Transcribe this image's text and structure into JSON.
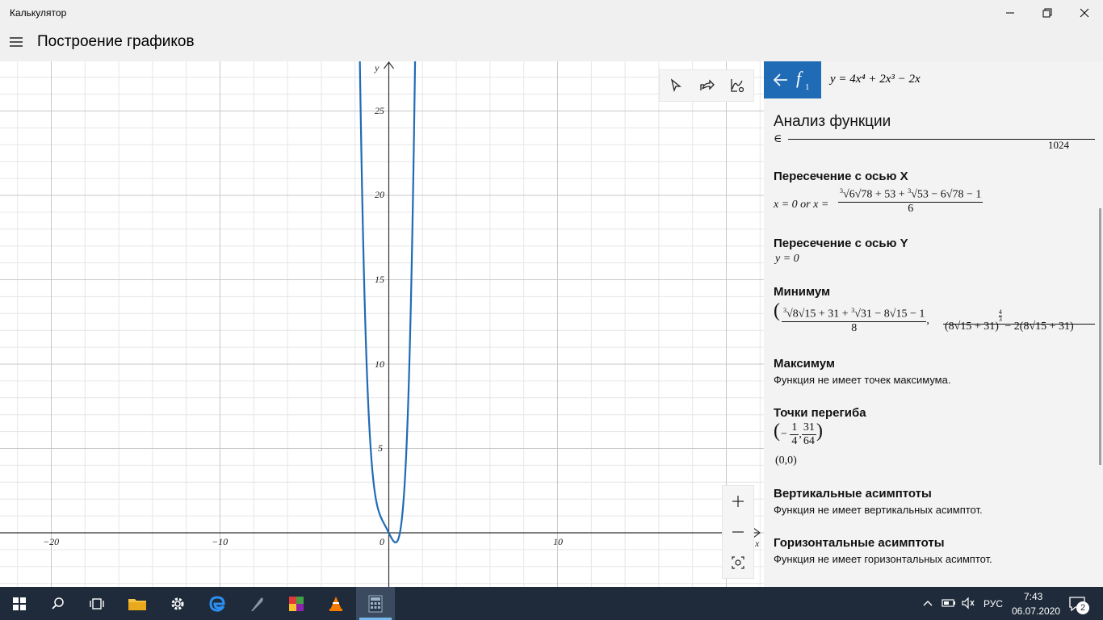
{
  "window": {
    "title": "Калькулятор"
  },
  "header": {
    "mode_title": "Построение графиков"
  },
  "graph": {
    "axis_x_label": "x",
    "axis_y_label": "y",
    "x_ticks": [
      "−20",
      "−10",
      "0",
      "10"
    ],
    "y_ticks": [
      "5",
      "10",
      "15",
      "20",
      "25"
    ]
  },
  "function": {
    "name": "f",
    "index": "1",
    "expression": "y = 4x⁴ + 2x³ − 2x",
    "color": "#1f6bb5"
  },
  "analysis": {
    "title": "Анализ функции",
    "cut_denominator": "1024",
    "x_intercept": {
      "title": "Пересечение с осью X",
      "lhs": "x = 0 or x =",
      "num_a": "6√78 + 53",
      "plus": "+",
      "num_b": "53 − 6√78",
      "minus": "− 1",
      "den": "6"
    },
    "y_intercept": {
      "title": "Пересечение с осью Y",
      "value": "y = 0"
    },
    "minimum": {
      "title": "Минимум",
      "num_a": "8√15 + 31",
      "plus": "+",
      "num_b": "31 − 8√15",
      "minus": "− 1",
      "den": "8",
      "second": "(8√15 + 31)",
      "exp_num": "4",
      "exp_den": "3",
      "second_tail": "− 2(8√15 + 31)"
    },
    "maximum": {
      "title": "Максимум",
      "text": "Функция не имеет точек максимума."
    },
    "inflection": {
      "title": "Точки перегиба",
      "p1_num": "1",
      "p1_den": "4",
      "p2_num": "31",
      "p2_den": "64",
      "origin": "(0,0)"
    },
    "vertical": {
      "title": "Вертикальные асимптоты",
      "text": "Функция не имеет вертикальных асимптот."
    },
    "horizontal": {
      "title": "Горизонтальные асимптоты",
      "text": "Функция не имеет горизонтальных асимптот."
    }
  },
  "taskbar": {
    "lang": "РУС",
    "time": "7:43",
    "date": "06.07.2020",
    "notifications": "2"
  }
}
